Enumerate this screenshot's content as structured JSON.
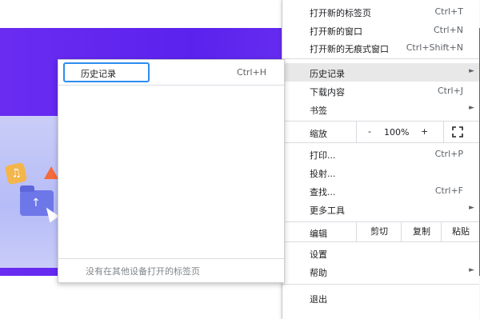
{
  "menu": {
    "items": [
      {
        "label": "打开新的标签页",
        "shortcut": "Ctrl+T"
      },
      {
        "label": "打开新的窗口",
        "shortcut": "Ctrl+N"
      },
      {
        "label": "打开新的无痕式窗口",
        "shortcut": "Ctrl+Shift+N"
      },
      {
        "label": "历史记录",
        "shortcut": ""
      },
      {
        "label": "下载内容",
        "shortcut": "Ctrl+J"
      },
      {
        "label": "书签",
        "shortcut": ""
      }
    ],
    "zoom": {
      "label": "缩放",
      "minus": "-",
      "value": "100%",
      "plus": "+"
    },
    "items2": [
      {
        "label": "打印...",
        "shortcut": "Ctrl+P"
      },
      {
        "label": "投射...",
        "shortcut": ""
      },
      {
        "label": "查找...",
        "shortcut": "Ctrl+F"
      },
      {
        "label": "更多工具",
        "shortcut": ""
      }
    ],
    "edit": {
      "label": "编辑",
      "cut": "剪切",
      "copy": "复制",
      "paste": "粘贴"
    },
    "items3": [
      {
        "label": "设置"
      },
      {
        "label": "帮助"
      }
    ],
    "exit": "退出",
    "arrow": "►"
  },
  "submenu": {
    "history_label": "历史记录",
    "history_shortcut": "Ctrl+H",
    "footer": "没有在其他设备打开的标签页"
  },
  "background": {
    "tile_icon": "♫",
    "folder_arrow": "↑"
  },
  "colors": {
    "accent": "#2d8cf0",
    "banner": "#5b22ee"
  }
}
